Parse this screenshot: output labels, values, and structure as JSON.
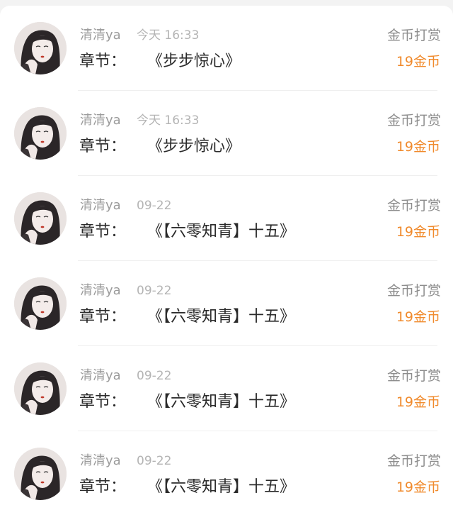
{
  "colors": {
    "accent_orange": "#f08a2c",
    "username_gray": "#9b9b9b",
    "time_gray": "#b4b4b4",
    "title_dark": "#2a2a2a",
    "background": "#f3f3f3"
  },
  "records": [
    {
      "username": "清清ya",
      "time": "今天 16:33",
      "chapter_label": "章节：",
      "chapter_title": "《步步惊心》",
      "type": "金币打赏",
      "amount": "19金币"
    },
    {
      "username": "清清ya",
      "time": "今天 16:33",
      "chapter_label": "章节：",
      "chapter_title": "《步步惊心》",
      "type": "金币打赏",
      "amount": "19金币"
    },
    {
      "username": "清清ya",
      "time": "09-22",
      "chapter_label": "章节：",
      "chapter_title": "《【六零知青】十五》",
      "type": "金币打赏",
      "amount": "19金币"
    },
    {
      "username": "清清ya",
      "time": "09-22",
      "chapter_label": "章节：",
      "chapter_title": "《【六零知青】十五》",
      "type": "金币打赏",
      "amount": "19金币"
    },
    {
      "username": "清清ya",
      "time": "09-22",
      "chapter_label": "章节：",
      "chapter_title": "《【六零知青】十五》",
      "type": "金币打赏",
      "amount": "19金币"
    },
    {
      "username": "清清ya",
      "time": "09-22",
      "chapter_label": "章节：",
      "chapter_title": "《【六零知青】十五》",
      "type": "金币打赏",
      "amount": "19金币"
    }
  ]
}
